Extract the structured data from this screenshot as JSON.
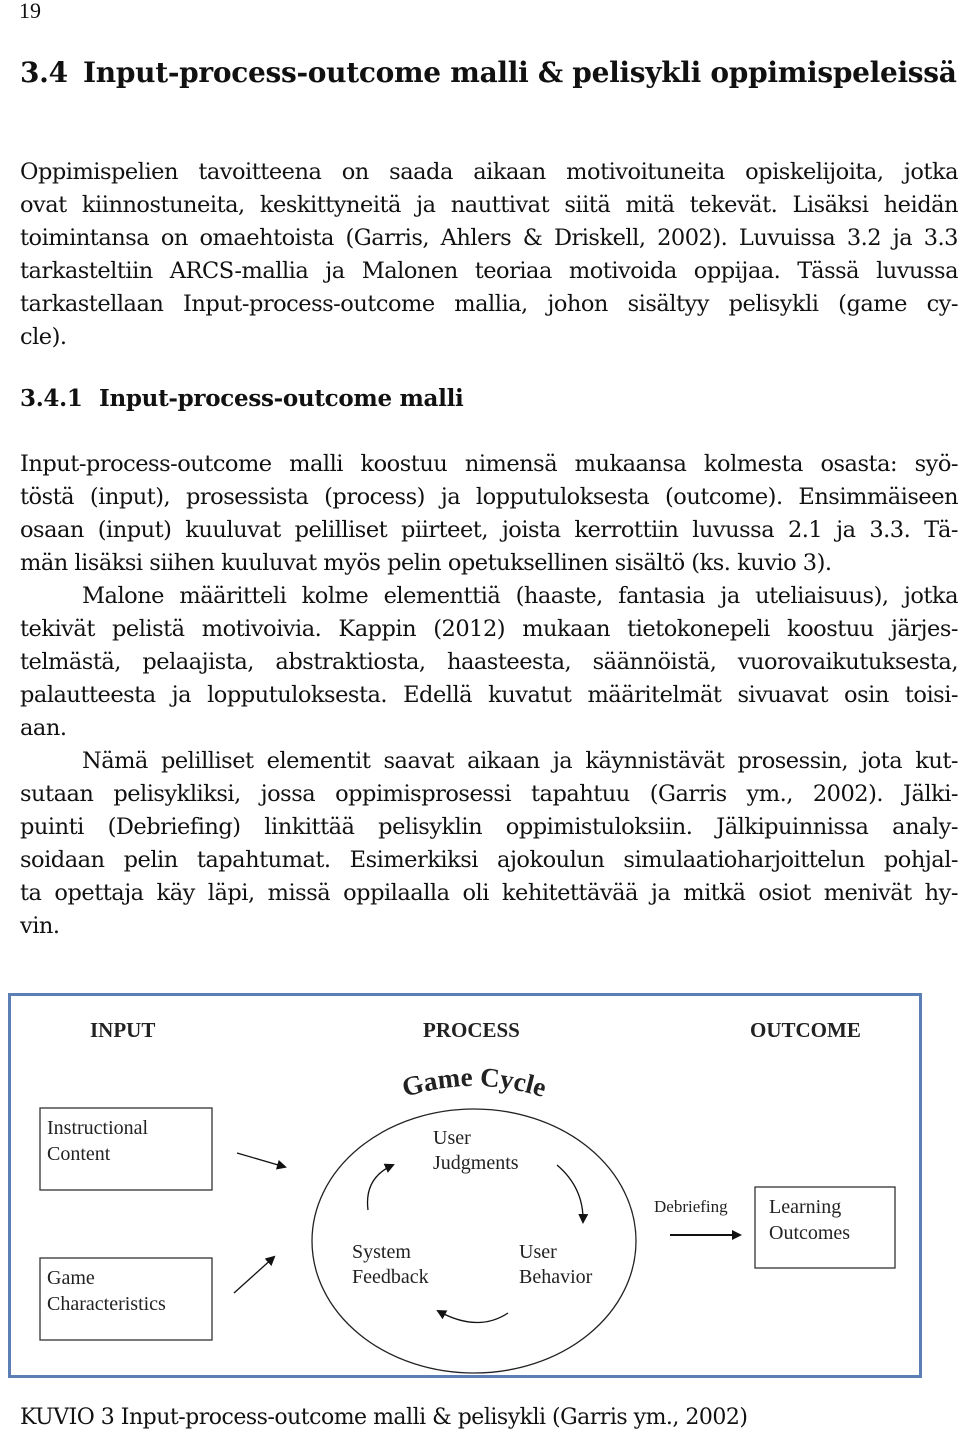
{
  "page_number": "19",
  "section": {
    "number": "3.4",
    "title": "Input-process-outcome malli & pelisykli oppimispeleissä"
  },
  "paragraph1": [
    "Oppimispelien tavoitteena on saada aikaan motivoituneita opiskelijoita, jotka",
    "ovat kiinnostuneita, keskittyneitä ja nauttivat siitä mitä tekevät. Lisäksi heidän",
    "toimintansa on omaehtoista (Garris, Ahlers & Driskell, 2002). Luvuissa 3.2 ja 3.3",
    "tarkasteltiin ARCS-mallia ja Malonen teoriaa motivoida oppijaa. Tässä luvussa",
    "tarkastellaan Input-process-outcome mallia, johon sisältyy pelisykli (game cy-",
    "cle)."
  ],
  "subsection": {
    "number": "3.4.1",
    "title": "Input-process-outcome malli"
  },
  "paragraph2": [
    "Input-process-outcome malli koostuu nimensä mukaansa kolmesta osasta: syö-",
    "töstä (input), prosessista (process) ja lopputuloksesta (outcome). Ensimmäiseen",
    "osaan (input) kuuluvat pelilliset piirteet, joista kerrottiin luvussa 2.1 ja 3.3. Tä-",
    "män lisäksi siihen kuuluvat myös pelin opetuksellinen sisältö (ks. kuvio 3).",
    "Malone määritteli kolme elementtiä (haaste, fantasia ja uteliaisuus), jotka",
    "tekivät pelistä motivoivia. Kappin (2012) mukaan tietokonepeli koostuu järjes-",
    "telmästä, pelaajista, abstraktiosta, haasteesta, säännöistä, vuorovaikutuksesta,",
    "palautteesta ja lopputuloksesta. Edellä kuvatut määritelmät sivuavat osin toisi-",
    "aan.",
    "Nämä pelilliset elementit saavat aikaan ja käynnistävät prosessin, jota kut-",
    "sutaan pelisykliksi, jossa oppimisprosessi tapahtuu (Garris ym., 2002). Jälki-",
    "puinti (Debriefing) linkittää pelisyklin oppimistuloksiin. Jälkipuinnissa analy-",
    "soidaan pelin tapahtumat. Esimerkiksi ajokoulun simulaatioharjoittelun pohjal-",
    "ta opettaja käy läpi, missä oppilaalla oli kehitettävää ja mitkä osiot menivät hy-",
    "vin."
  ],
  "figure": {
    "border_color": "#5b7fb5",
    "headers": {
      "input": "INPUT",
      "process": "PROCESS",
      "outcome": "OUTCOME"
    },
    "cycle_title": "Game Cycle",
    "input_boxes": [
      {
        "line1": "Instructional",
        "line2": "Content"
      },
      {
        "line1": "Game",
        "line2": "Characteristics"
      }
    ],
    "cycle_nodes": {
      "judgments": {
        "line1": "User",
        "line2": "Judgments"
      },
      "feedback": {
        "line1": "System",
        "line2": "Feedback"
      },
      "behavior": {
        "line1": "User",
        "line2": "Behavior"
      }
    },
    "debriefing": "Debriefing",
    "outcome_box": {
      "line1": "Learning",
      "line2": "Outcomes"
    }
  },
  "caption": "KUVIO 3 Input-process-outcome malli & pelisykli (Garris ym., 2002)"
}
